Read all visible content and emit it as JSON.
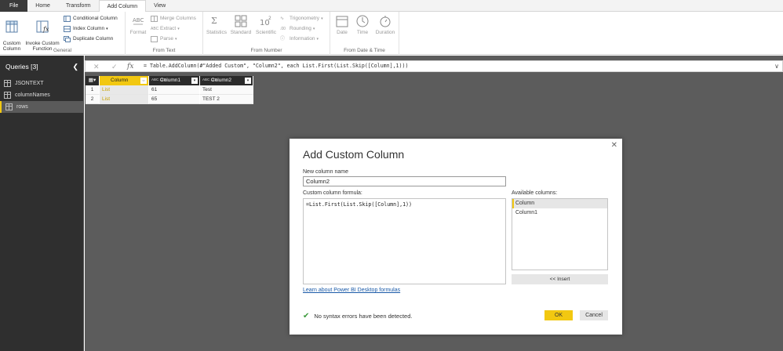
{
  "menu": {
    "tabs": [
      "File",
      "Home",
      "Transform",
      "Add Column",
      "View"
    ],
    "active_index": 3
  },
  "ribbon": {
    "general": {
      "label": "General",
      "custom_column": "Custom\nColumn",
      "invoke_custom_function": "Invoke Custom\nFunction",
      "conditional_column": "Conditional Column",
      "index_column": "Index Column",
      "duplicate_column": "Duplicate Column"
    },
    "from_text": {
      "label": "From Text",
      "format": "Format",
      "merge_columns": "Merge Columns",
      "extract": "Extract",
      "parse": "Parse"
    },
    "from_number": {
      "label": "From Number",
      "statistics": "Statistics",
      "standard": "Standard",
      "scientific": "Scientific",
      "trigonometry": "Trigonometry",
      "rounding": "Rounding",
      "information": "Information"
    },
    "from_date_time": {
      "label": "From Date & Time",
      "date": "Date",
      "time": "Time",
      "duration": "Duration"
    }
  },
  "queries": {
    "title": "Queries [3]",
    "items": [
      {
        "label": "JSONTEXT",
        "selected": false
      },
      {
        "label": "columnNames",
        "selected": false
      },
      {
        "label": "rows",
        "selected": true
      }
    ]
  },
  "formula_bar": {
    "fx": "fx",
    "text": "= Table.AddColumn(#\"Added Custom\", \"Column2\", each List.First(List.Skip([Column],1)))"
  },
  "grid": {
    "headers": [
      {
        "type": "",
        "name": "Column"
      },
      {
        "type": "ABC 123",
        "name": "Column1"
      },
      {
        "type": "ABC 123",
        "name": "Column2"
      }
    ],
    "rows": [
      {
        "index": "1",
        "cells": [
          "List",
          "61",
          "Test"
        ]
      },
      {
        "index": "2",
        "cells": [
          "List",
          "65",
          "TEST 2"
        ]
      }
    ]
  },
  "dialog": {
    "title": "Add Custom Column",
    "new_column_name_label": "New column name",
    "new_column_name_value": "Column2",
    "formula_label": "Custom column formula:",
    "formula_value": "=List.First(List.Skip([Column],1))",
    "available_columns_label": "Available columns:",
    "available_columns": [
      {
        "label": "Column",
        "selected": true
      },
      {
        "label": "Column1",
        "selected": false
      }
    ],
    "insert_button": "<< Insert",
    "learn_link": "Learn about Power BI Desktop formulas",
    "status_text": "No syntax errors have been detected.",
    "ok_button": "OK",
    "cancel_button": "Cancel",
    "close_glyph": "✕"
  },
  "colors": {
    "accent": "#f2c811",
    "dark": "#2f2f2f",
    "link": "#1a5aa8",
    "ok_check": "#3c9a3c"
  }
}
